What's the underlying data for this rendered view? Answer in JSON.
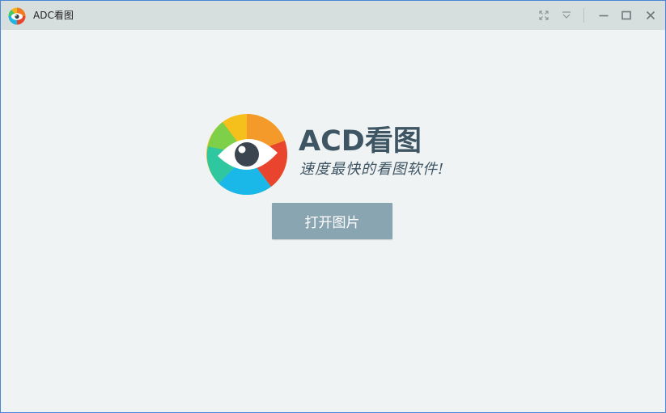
{
  "window": {
    "title": "ADC看图",
    "controls": {
      "fullscreen_icon": "fullscreen-icon",
      "dropdown_icon": "chevron-down-icon",
      "minimize_icon": "minimize-icon",
      "maximize_icon": "maximize-icon",
      "close_icon": "close-icon"
    }
  },
  "main": {
    "brand_name": "ACD看图",
    "slogan": "速度最快的看图软件!",
    "open_button_label": "打开图片"
  },
  "colors": {
    "titlebar": "#d7dfde",
    "background": "#f0f3f3",
    "brand_text": "#3e5564",
    "button": "#8aa5b2"
  }
}
